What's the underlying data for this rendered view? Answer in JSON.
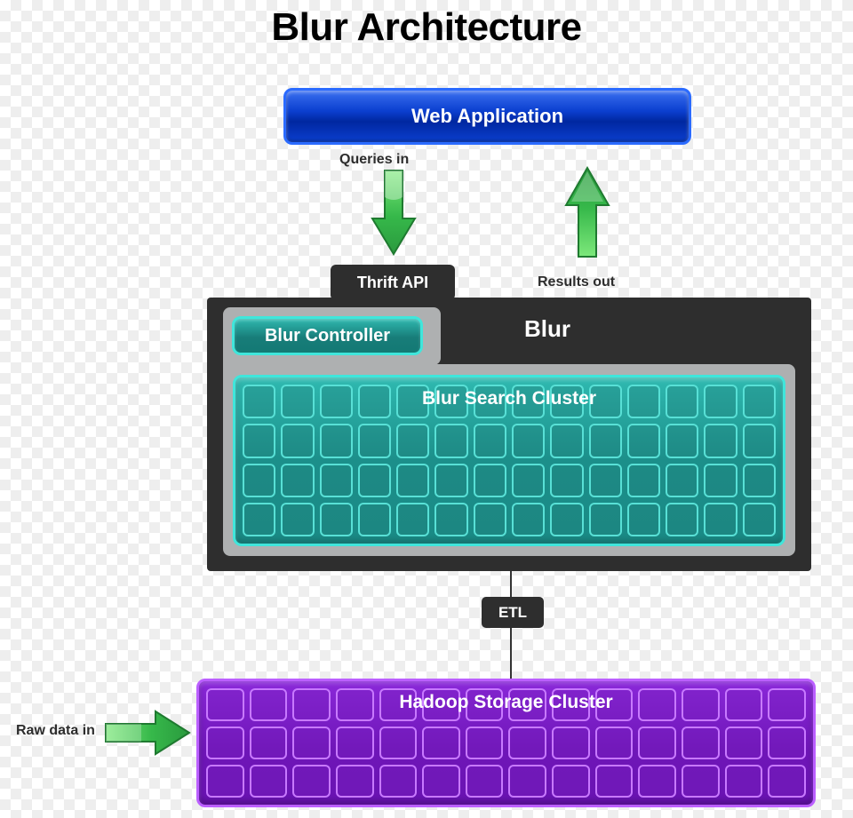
{
  "title": "Blur Architecture",
  "web_app": {
    "label": "Web Application"
  },
  "labels": {
    "queries_in": "Queries in",
    "results_out": "Results out",
    "raw_data_in": "Raw data in"
  },
  "thrift": {
    "label": "Thrift API"
  },
  "blur": {
    "label": "Blur",
    "controller_label": "Blur Controller",
    "search_cluster_label": "Blur Search Cluster"
  },
  "etl": {
    "label": "ETL"
  },
  "hadoop": {
    "label": "Hadoop Storage Cluster"
  },
  "colors": {
    "web_app": "#0b3fcf",
    "blur_panel": "#2e2e2e",
    "blur_cluster": "#1c8f8a",
    "hadoop_cluster": "#6f16b8",
    "arrow": "#4cc85a"
  }
}
